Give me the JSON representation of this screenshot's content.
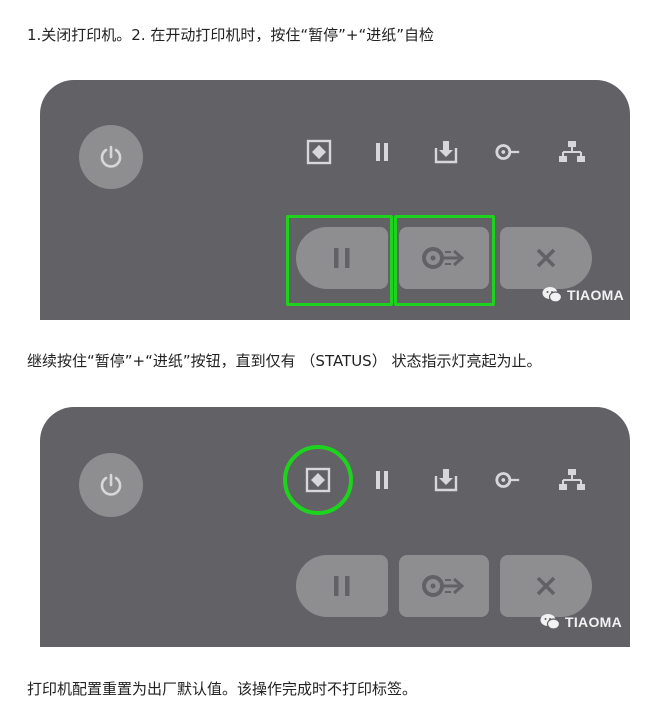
{
  "steps": {
    "step1": "1.关闭打印机。2. 在开动打印机时，按住“暂停”+“进纸”自检",
    "step2": "继续按住“暂停”+“进纸”按钮，直到仅有 （STATUS） 状态指示灯亮起为止。",
    "step3": "打印机配置重置为出厂默认值。该操作完成时不打印标签。"
  },
  "panels": [
    {
      "indicators": [
        "status-icon",
        "pause-icon",
        "data-icon",
        "supplies-icon",
        "network-icon"
      ],
      "buttons": [
        "pause-button",
        "feed-button",
        "cancel-button"
      ],
      "highlight": [
        "pause-button",
        "feed-button"
      ],
      "watermark": "TIAOMA"
    },
    {
      "indicators": [
        "status-icon",
        "pause-icon",
        "data-icon",
        "supplies-icon",
        "network-icon"
      ],
      "buttons": [
        "pause-button",
        "feed-button",
        "cancel-button"
      ],
      "highlight": [
        "status-indicator"
      ],
      "watermark": "TIAOMA"
    }
  ],
  "colors": {
    "panel": "#626166",
    "button": "#8e8d90",
    "icon": "#d7d7d9",
    "highlight": "#1ed31e"
  }
}
